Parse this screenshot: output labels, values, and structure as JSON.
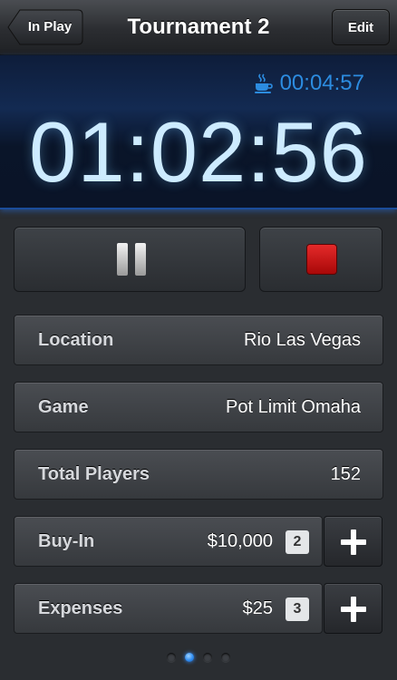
{
  "nav": {
    "back_label": "In Play",
    "title": "Tournament 2",
    "edit_label": "Edit"
  },
  "timer": {
    "break_time": "00:04:57",
    "elapsed": "01:02:56",
    "break_icon": "coffee-cup-icon"
  },
  "controls": {
    "pause_icon": "pause-icon",
    "stop_icon": "stop-icon",
    "stop_color": "#cc1111"
  },
  "rows": {
    "location": {
      "label": "Location",
      "value": "Rio Las Vegas"
    },
    "game": {
      "label": "Game",
      "value": "Pot Limit Omaha"
    },
    "total_players": {
      "label": "Total Players",
      "value": "152"
    },
    "buy_in": {
      "label": "Buy-In",
      "value": "$10,000",
      "count": "2"
    },
    "expenses": {
      "label": "Expenses",
      "value": "$25",
      "count": "3"
    }
  },
  "pager": {
    "pages": 4,
    "current": 2
  },
  "colors": {
    "accent_blue": "#2c8ce0",
    "timer_text": "#cdebff"
  }
}
